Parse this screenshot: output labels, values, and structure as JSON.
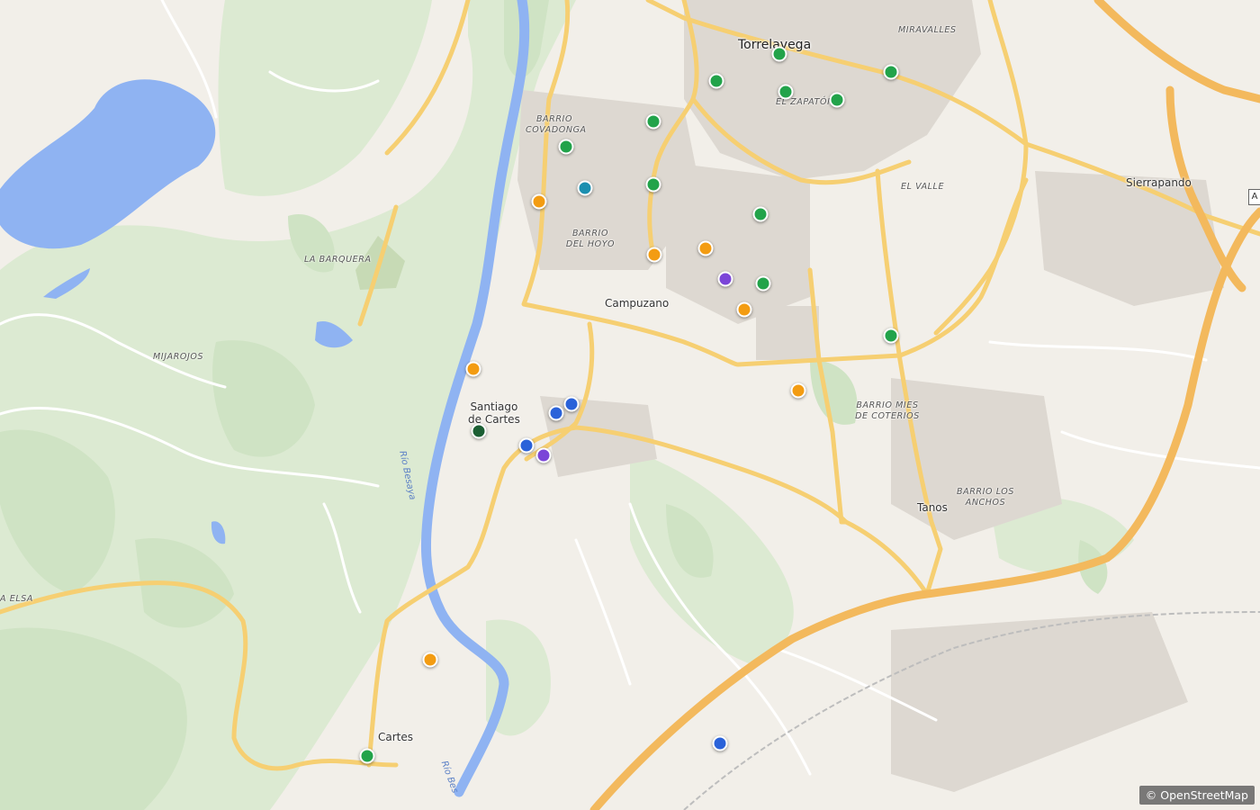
{
  "map": {
    "labels": {
      "torrelavega": "Torrelavega",
      "miravalles": "MIRAVALLES",
      "el_zapaton": "EL ZAPATÓN",
      "barrio_covadonga_1": "BARRIO",
      "barrio_covadonga_2": "COVADONGA",
      "barrio_del_hoyo_1": "BARRIO",
      "barrio_del_hoyo_2": "DEL HOYO",
      "el_valle": "EL VALLE",
      "sierrapando": "Sierrapando",
      "la_barquera": "LA BARQUERA",
      "campuzano": "Campuzano",
      "mijarojos": "MIJAROJOS",
      "santiago_1": "Santiago",
      "santiago_2": "de Cartes",
      "barrio_mies_1": "BARRIO MIES",
      "barrio_mies_2": "DE COTERIOS",
      "barrio_los_ancho_1": "BARRIO LOS",
      "barrio_los_ancho_2": "ANCHOS",
      "tanos": "Tanos",
      "cartes": "Cartes",
      "la_elsa": "A ELSA",
      "rio_besaya_1": "Río Besaya",
      "rio_besaya_2": "Río Bes",
      "edge_sign": "A"
    },
    "attribution": "© OpenStreetMap",
    "marker_colors": {
      "green": "#22a34a",
      "orange": "#f39c12",
      "blue": "#2a62d9",
      "teal": "#1b8fb0",
      "purple": "#7b45d8",
      "darkgreen": "#1b5e33"
    },
    "base_colors": {
      "land": "#f2efe9",
      "forest": "#d9ead0",
      "water": "#8fb3f2",
      "road_major": "#f6cf72",
      "motorway": "#f3b95d",
      "building": "#d9d5cf"
    }
  }
}
